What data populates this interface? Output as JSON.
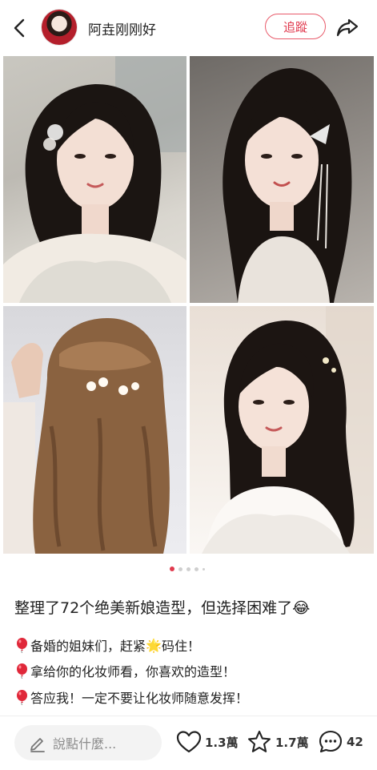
{
  "header": {
    "username": "阿垚刚刚好",
    "follow_label": "追蹤"
  },
  "gallery": {
    "photo_count": 4,
    "page_count": 5,
    "active_page": 1
  },
  "post": {
    "title": "整理了72个绝美新娘造型，但选择困难了😂",
    "lines": [
      {
        "text_before": "备婚的姐妹们，赶紧",
        "emoji": "🌟",
        "text_after": "码住！"
      },
      {
        "text": "拿给你的化妆师看，你喜欢的造型！"
      },
      {
        "text": "答应我！一定不要让化妆师随意发挥！"
      }
    ]
  },
  "bottom_bar": {
    "comment_placeholder": "說點什麼...",
    "like_count": "1.3萬",
    "favorite_count": "1.7萬",
    "comment_count": "42"
  },
  "colors": {
    "accent": "#e03a4e",
    "follow_border": "#e85a6a"
  }
}
